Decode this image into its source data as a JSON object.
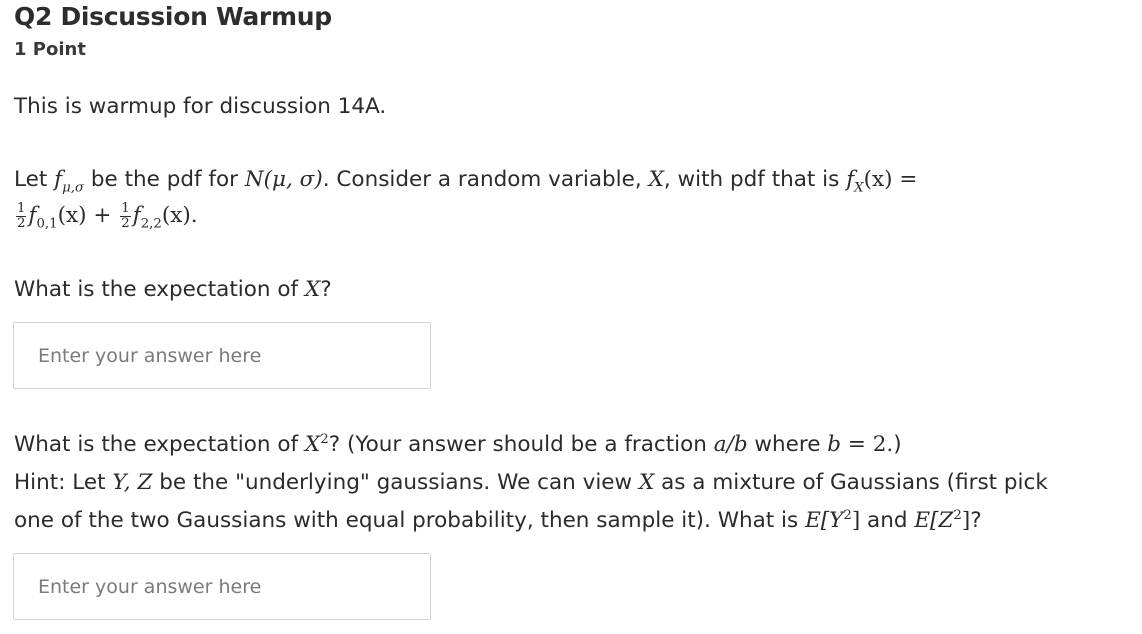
{
  "question": {
    "title": "Q2 Discussion Warmup",
    "points": "1 Point",
    "intro": "This is warmup for discussion 14A.",
    "def": {
      "t1": "Let ",
      "f_sym": "f",
      "f_sub": "μ,σ",
      "t2": " be the pdf for ",
      "N": "N",
      "N_args": "(μ, σ)",
      "t3": ". Consider a random variable, ",
      "X": "X",
      "t4": ", with pdf that is ",
      "fX": "f",
      "fX_sub": "X",
      "fX_arg": "(x) =",
      "half": "1",
      "two": "2",
      "f01": "f",
      "f01_sub": "0,1",
      "f01_arg": "(x) + ",
      "f22": "f",
      "f22_sub": "2,2",
      "f22_arg": "(x)."
    },
    "q1": {
      "t1": "What is the expectation of ",
      "X": "X",
      "t2": "?",
      "placeholder": "Enter your answer here"
    },
    "q2": {
      "t1": "What is the expectation of ",
      "X": "X",
      "sup": "2",
      "t2": "? (Your answer should be a fraction ",
      "ab": "a/b",
      "t3": " where ",
      "b": "b",
      "eq": " = 2.",
      "t4": ")",
      "hint1": "Hint: Let ",
      "YZ": "Y, Z",
      "hint2": " be the \"underlying\" gaussians.  We can view ",
      "X2": "X",
      "hint3": " as a mixture of Gaussians (first pick",
      "hint4": "one of the two Gaussians with equal probability, then sample it).  What is ",
      "EY": "E[Y",
      "EY_sup": "2",
      "EY_close": "]",
      "and": " and ",
      "EZ": "E[Z",
      "EZ_sup": "2",
      "EZ_close": "]",
      "q": "?",
      "placeholder": "Enter your answer here"
    }
  }
}
